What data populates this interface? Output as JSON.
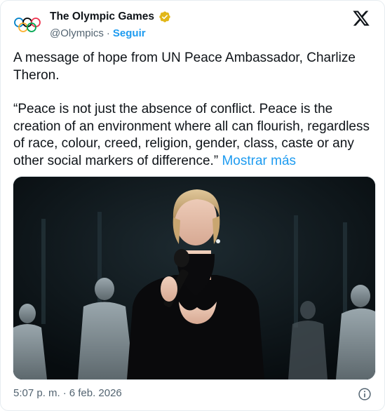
{
  "account": {
    "display_name": "The Olympic Games",
    "handle": "@Olympics",
    "separator": "·",
    "follow_label": "Seguir"
  },
  "post": {
    "paragraph_1": "A message of hope from UN Peace Ambassador, Charlize Theron.",
    "paragraph_2": "“Peace is not just the absence of conflict. Peace is the creation of an environment where all can flourish, regardless of race, colour, creed, religion, gender, class, caste or any other social markers of difference.”",
    "show_more_label": "Mostrar más"
  },
  "footer": {
    "time": "5:07 p. m.",
    "separator": "·",
    "date": "6 feb. 2026"
  },
  "icons": {
    "logo": "olympic-rings-icon",
    "verified": "verified-gold-badge-icon",
    "platform": "x-logo-icon",
    "info": "info-icon"
  },
  "colors": {
    "accent": "#1d9bf0",
    "text": "#0f1419",
    "muted": "#536471",
    "verified_gold": "#e2b719"
  }
}
